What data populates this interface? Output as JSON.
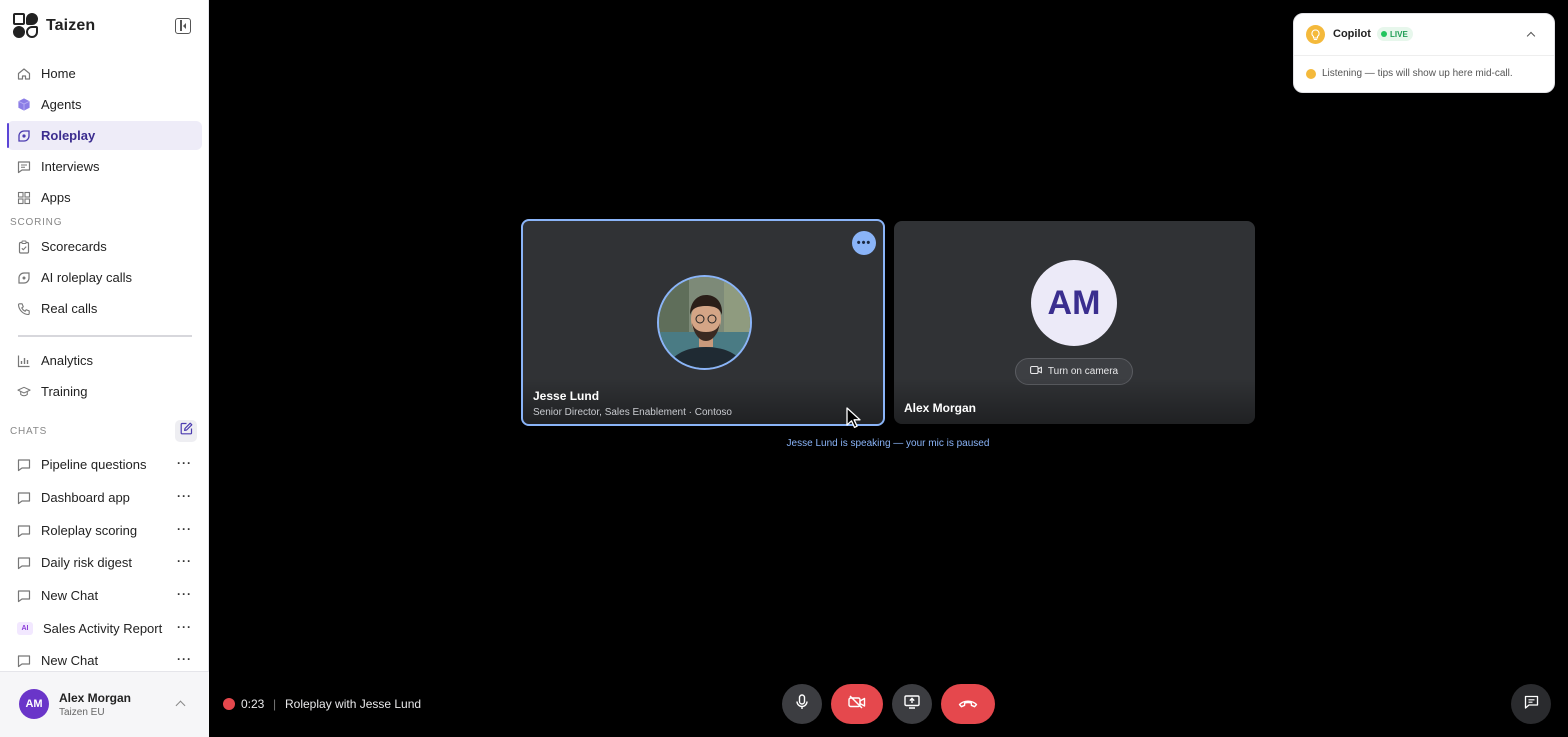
{
  "app": {
    "name": "Taizen"
  },
  "nav": {
    "items": [
      {
        "label": "Home",
        "icon": "home-icon"
      },
      {
        "label": "Agents",
        "icon": "cube-icon"
      },
      {
        "label": "Roleplay",
        "icon": "roleplay-icon",
        "active": true
      },
      {
        "label": "Interviews",
        "icon": "message-square-icon"
      },
      {
        "label": "Apps",
        "icon": "grid-icon"
      }
    ],
    "scoring_label": "SCORING",
    "scoring_items": [
      {
        "label": "Scorecards",
        "icon": "clipboard-icon"
      },
      {
        "label": "AI roleplay calls",
        "icon": "roleplay-icon"
      },
      {
        "label": "Real calls",
        "icon": "phone-icon"
      }
    ],
    "other_items": [
      {
        "label": "Analytics",
        "icon": "bar-chart-icon"
      },
      {
        "label": "Training",
        "icon": "graduation-cap-icon"
      }
    ],
    "chats_label": "CHATS",
    "chats": [
      {
        "label": "Pipeline questions"
      },
      {
        "label": "Dashboard app"
      },
      {
        "label": "Roleplay scoring"
      },
      {
        "label": "Daily risk digest"
      },
      {
        "label": "New Chat"
      },
      {
        "label": "Sales Activity Report",
        "badge": "AI"
      },
      {
        "label": "New Chat"
      }
    ]
  },
  "user": {
    "initials": "AM",
    "name": "Alex Morgan",
    "org": "Taizen EU"
  },
  "call": {
    "timer": "0:23",
    "separator": "|",
    "title": "Roleplay with Jesse Lund",
    "speaking_note": "Jesse Lund is speaking — your mic is paused",
    "participants": {
      "jesse": {
        "name": "Jesse Lund",
        "subtitle": "Senior Director, Sales Enablement · Contoso"
      },
      "alex": {
        "initials": "AM",
        "name": "Alex Morgan",
        "camera_button": "Turn on camera"
      }
    }
  },
  "copilot": {
    "title": "Copilot",
    "badge": "LIVE",
    "message": "Listening — tips will show up here mid-call."
  },
  "colors": {
    "accent": "#5b45d6",
    "speaker_highlight": "#8ab4f8",
    "danger": "#e5484d",
    "live": "#22c55e"
  }
}
